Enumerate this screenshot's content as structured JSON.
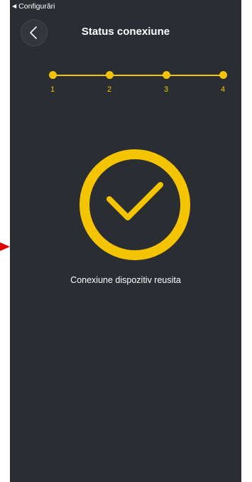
{
  "status_bar": {
    "back_app_label": "Configurări",
    "back_glyph": "◀"
  },
  "header": {
    "title": "Status conexiune",
    "back_icon": "chevron-left-icon"
  },
  "stepper": {
    "steps": [
      "1",
      "2",
      "3",
      "4"
    ],
    "current_step": 4,
    "total_steps": 4
  },
  "result": {
    "icon": "checkmark-circle-icon",
    "message": "Conexiune dispozitiv reusita"
  },
  "colors": {
    "background": "#2a2d31",
    "accent": "#f5c400",
    "text": "#ffffff",
    "indicator_arrow": "#e00000"
  }
}
